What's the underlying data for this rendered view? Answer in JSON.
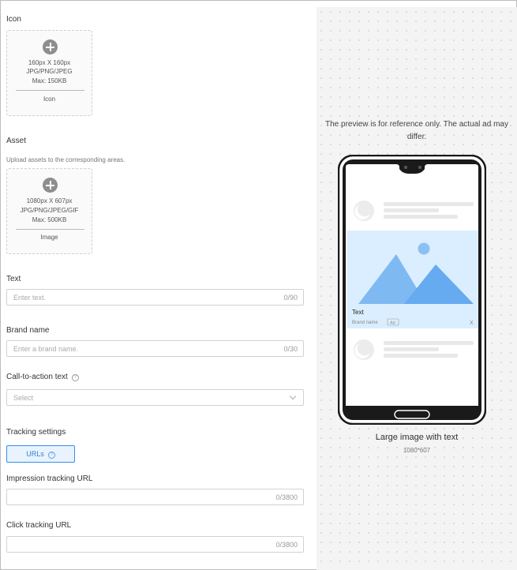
{
  "form": {
    "icon": {
      "label": "Icon",
      "spec_line1": "160px X 160px",
      "spec_line2": "JPG/PNG/JPEG",
      "spec_line3": "Max: 150KB",
      "caption": "Icon"
    },
    "asset": {
      "label": "Asset",
      "hint": "Upload assets to the corresponding areas.",
      "spec_line1": "1080px X 607px",
      "spec_line2": "JPG/PNG/JPEG/GIF",
      "spec_line3": "Max: 500KB",
      "caption": "Image"
    },
    "text": {
      "label": "Text",
      "placeholder": "Enter text.",
      "counter": "0/90"
    },
    "brand": {
      "label": "Brand name",
      "placeholder": "Enter a brand name.",
      "counter": "0/30"
    },
    "cta": {
      "label": "Call-to-action text",
      "help": "?",
      "placeholder": "Select"
    },
    "tracking": {
      "label": "Tracking settings",
      "button": "URLs",
      "help": "?"
    },
    "impression": {
      "label": "Impression tracking URL",
      "counter": "0/3800"
    },
    "click": {
      "label": "Click tracking URL",
      "counter": "0/3800"
    }
  },
  "preview": {
    "note": "The preview is for reference only. The actual ad may differ.",
    "ad_text": "Text",
    "brand_name": "Brand name",
    "ad_badge": "Ad",
    "close": "X",
    "caption": "Large image with text",
    "size": "1080*607"
  }
}
